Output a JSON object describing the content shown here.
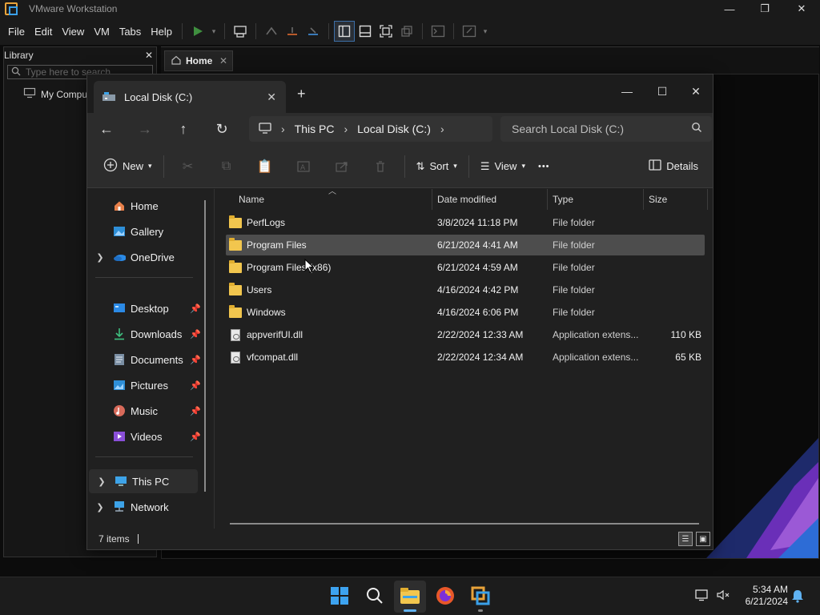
{
  "vmware": {
    "title": "VMware Workstation",
    "menu": [
      "File",
      "Edit",
      "View",
      "VM",
      "Tabs",
      "Help"
    ],
    "window_controls": {
      "minimize": "—",
      "restore": "❐",
      "close": "✕"
    },
    "library": {
      "title": "Library",
      "close": "✕",
      "search_placeholder": "Type here to search",
      "tree_item": "My Computer"
    },
    "tab": {
      "label": "Home",
      "close": "✕"
    }
  },
  "explorer": {
    "tab_title": "Local Disk (C:)",
    "tab_close": "✕",
    "new_tab": "+",
    "window_controls": {
      "minimize": "—",
      "maximize": "☐",
      "close": "✕"
    },
    "nav": {
      "back": "←",
      "forward": "→",
      "up": "↑",
      "refresh": "↻"
    },
    "breadcrumb": [
      "This PC",
      "Local Disk (C:)"
    ],
    "search_placeholder": "Search Local Disk (C:)",
    "commands": {
      "new": "New",
      "sort": "Sort",
      "view": "View",
      "more": "•••",
      "details": "Details"
    },
    "nav_pane": {
      "top": [
        {
          "label": "Home",
          "icon": "home-icon"
        },
        {
          "label": "Gallery",
          "icon": "gallery-icon"
        },
        {
          "label": "OneDrive",
          "icon": "onedrive-icon",
          "expandable": true
        }
      ],
      "quick": [
        {
          "label": "Desktop",
          "icon": "desktop-icon"
        },
        {
          "label": "Downloads",
          "icon": "downloads-icon"
        },
        {
          "label": "Documents",
          "icon": "documents-icon"
        },
        {
          "label": "Pictures",
          "icon": "pictures-icon"
        },
        {
          "label": "Music",
          "icon": "music-icon"
        },
        {
          "label": "Videos",
          "icon": "videos-icon"
        }
      ],
      "bottom": [
        {
          "label": "This PC",
          "icon": "this-pc-icon",
          "selected": true
        },
        {
          "label": "Network",
          "icon": "network-icon"
        }
      ]
    },
    "columns": [
      "Name",
      "Date modified",
      "Type",
      "Size"
    ],
    "rows": [
      {
        "name": "PerfLogs",
        "date": "3/8/2024 11:18 PM",
        "type": "File folder",
        "size": "",
        "kind": "folder"
      },
      {
        "name": "Program Files",
        "date": "6/21/2024 4:41 AM",
        "type": "File folder",
        "size": "",
        "kind": "folder",
        "selected": true
      },
      {
        "name": "Program Files (x86)",
        "date": "6/21/2024 4:59 AM",
        "type": "File folder",
        "size": "",
        "kind": "folder"
      },
      {
        "name": "Users",
        "date": "4/16/2024 4:42 PM",
        "type": "File folder",
        "size": "",
        "kind": "folder"
      },
      {
        "name": "Windows",
        "date": "4/16/2024 6:06 PM",
        "type": "File folder",
        "size": "",
        "kind": "folder"
      },
      {
        "name": "appverifUI.dll",
        "date": "2/22/2024 12:33 AM",
        "type": "Application extens...",
        "size": "110 KB",
        "kind": "file"
      },
      {
        "name": "vfcompat.dll",
        "date": "2/22/2024 12:34 AM",
        "type": "Application extens...",
        "size": "65 KB",
        "kind": "file"
      }
    ],
    "status": "7 items"
  },
  "taskbar": {
    "apps": [
      "start-icon",
      "search-icon",
      "file-explorer-icon",
      "firefox-icon",
      "vmware-icon"
    ],
    "time": "5:34 AM",
    "date": "6/21/2024"
  },
  "colors": {
    "accent": "#5fb2f2",
    "folder": "#f2c64e",
    "selection": "#4d4d4d"
  }
}
